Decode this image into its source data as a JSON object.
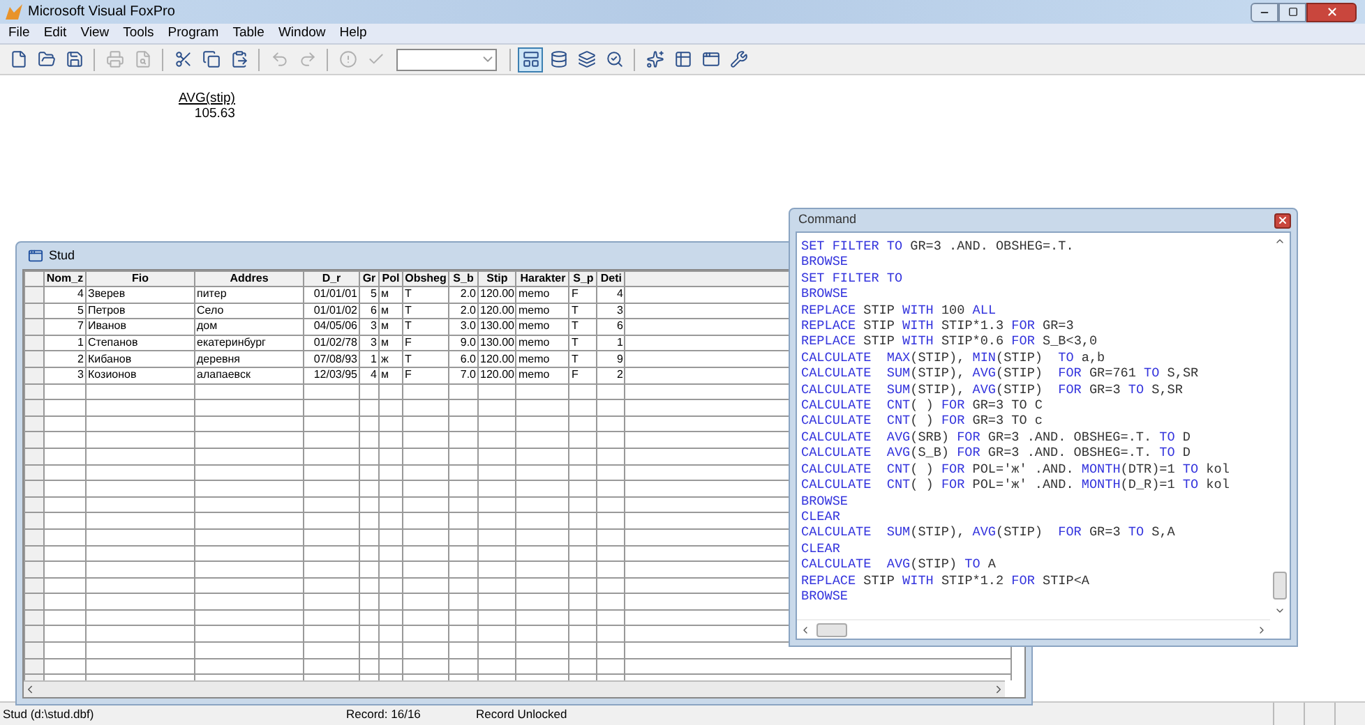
{
  "window": {
    "title": "Microsoft Visual FoxPro"
  },
  "menu": [
    "File",
    "Edit",
    "View",
    "Tools",
    "Program",
    "Table",
    "Window",
    "Help"
  ],
  "toolbar": [
    {
      "kind": "button",
      "disabled": false
    },
    {
      "kind": "button",
      "disabled": false
    },
    {
      "kind": "button",
      "disabled": false
    },
    {
      "kind": "separator"
    },
    {
      "kind": "button",
      "disabled": true
    },
    {
      "kind": "button",
      "disabled": true
    },
    {
      "kind": "separator"
    },
    {
      "kind": "button",
      "disabled": false
    },
    {
      "kind": "button",
      "disabled": false
    },
    {
      "kind": "button",
      "disabled": false
    },
    {
      "kind": "separator"
    },
    {
      "kind": "button",
      "disabled": true
    },
    {
      "kind": "button",
      "disabled": true
    },
    {
      "kind": "separator"
    },
    {
      "kind": "button",
      "disabled": true
    },
    {
      "kind": "button",
      "disabled": true
    },
    {
      "kind": "combo"
    },
    {
      "kind": "separator"
    },
    {
      "kind": "button",
      "disabled": false,
      "selected": true
    },
    {
      "kind": "button",
      "disabled": false,
      "selected": false
    },
    {
      "kind": "button",
      "disabled": false,
      "selected": false
    },
    {
      "kind": "button",
      "disabled": false,
      "selected": false
    },
    {
      "kind": "separator"
    },
    {
      "kind": "button",
      "disabled": false
    },
    {
      "kind": "button",
      "disabled": false
    },
    {
      "kind": "button",
      "disabled": false
    },
    {
      "kind": "button",
      "disabled": false
    }
  ],
  "output": {
    "heading": "AVG(stip)",
    "value": "105.63"
  },
  "browse_window": {
    "title": "Stud",
    "columns": [
      "Nom_z",
      "Fio",
      "Addres",
      "D_r",
      "Gr",
      "Pol",
      "Obsheg",
      "S_b",
      "Stip",
      "Harakter",
      "S_p",
      "Deti"
    ],
    "rows": [
      [
        "4",
        "Зверев",
        "питер",
        "01/01/01",
        "5",
        "м",
        "T",
        "2.0",
        "120.00",
        "memo",
        "F",
        "4"
      ],
      [
        "5",
        "Петров",
        "Село",
        "01/01/02",
        "6",
        "м",
        "T",
        "2.0",
        "120.00",
        "memo",
        "T",
        "3"
      ],
      [
        "7",
        "Иванов",
        "дом",
        "04/05/06",
        "3",
        "м",
        "T",
        "3.0",
        "130.00",
        "memo",
        "T",
        "6"
      ],
      [
        "1",
        "Степанов",
        "екатеринбург",
        "01/02/78",
        "3",
        "м",
        "F",
        "9.0",
        "130.00",
        "memo",
        "T",
        "1"
      ],
      [
        "2",
        "Кибанов",
        "деревня",
        "07/08/93",
        "1",
        "ж",
        "T",
        "6.0",
        "120.00",
        "memo",
        "T",
        "9"
      ],
      [
        "3",
        "Козионов",
        "алапаевск",
        "12/03/95",
        "4",
        "м",
        "F",
        "7.0",
        "120.00",
        "memo",
        "F",
        "2"
      ]
    ]
  },
  "command_window": {
    "title": "Command",
    "lines": [
      [
        {
          "kind": "kw",
          "text": "SET FILTER TO"
        },
        {
          "kind": "plain",
          "text": " GR=3 .AND. OBSHEG=.T."
        }
      ],
      [
        {
          "kind": "kw",
          "text": "BROWSE"
        }
      ],
      [
        {
          "kind": "kw",
          "text": "SET FILTER TO"
        }
      ],
      [
        {
          "kind": "kw",
          "text": "BROWSE"
        }
      ],
      [
        {
          "kind": "kw",
          "text": "REPLACE"
        },
        {
          "kind": "plain",
          "text": " STIP "
        },
        {
          "kind": "kw",
          "text": "WITH"
        },
        {
          "kind": "plain",
          "text": " 100 "
        },
        {
          "kind": "kw",
          "text": "ALL"
        }
      ],
      [
        {
          "kind": "kw",
          "text": "REPLACE"
        },
        {
          "kind": "plain",
          "text": " STIP "
        },
        {
          "kind": "kw",
          "text": "WITH"
        },
        {
          "kind": "plain",
          "text": " STIP*1.3 "
        },
        {
          "kind": "kw",
          "text": "FOR"
        },
        {
          "kind": "plain",
          "text": " GR=3"
        }
      ],
      [
        {
          "kind": "kw",
          "text": "REPLACE"
        },
        {
          "kind": "plain",
          "text": " STIP "
        },
        {
          "kind": "kw",
          "text": "WITH"
        },
        {
          "kind": "plain",
          "text": " STIP*0.6 "
        },
        {
          "kind": "kw",
          "text": "FOR"
        },
        {
          "kind": "plain",
          "text": " S_B<3,0"
        }
      ],
      [
        {
          "kind": "kw",
          "text": "CALCULATE  MAX"
        },
        {
          "kind": "plain",
          "text": "(STIP), "
        },
        {
          "kind": "kw",
          "text": "MIN"
        },
        {
          "kind": "plain",
          "text": "(STIP)  "
        },
        {
          "kind": "kw",
          "text": "TO"
        },
        {
          "kind": "plain",
          "text": " a,b"
        }
      ],
      [
        {
          "kind": "kw",
          "text": "CALCULATE  SUM"
        },
        {
          "kind": "plain",
          "text": "(STIP), "
        },
        {
          "kind": "kw",
          "text": "AVG"
        },
        {
          "kind": "plain",
          "text": "(STIP)  "
        },
        {
          "kind": "kw",
          "text": "FOR"
        },
        {
          "kind": "plain",
          "text": " GR=761 "
        },
        {
          "kind": "kw",
          "text": "TO"
        },
        {
          "kind": "plain",
          "text": " S,SR"
        }
      ],
      [
        {
          "kind": "kw",
          "text": "CALCULATE  SUM"
        },
        {
          "kind": "plain",
          "text": "(STIP), "
        },
        {
          "kind": "kw",
          "text": "AVG"
        },
        {
          "kind": "plain",
          "text": "(STIP)  "
        },
        {
          "kind": "kw",
          "text": "FOR"
        },
        {
          "kind": "plain",
          "text": " GR=3 "
        },
        {
          "kind": "kw",
          "text": "TO"
        },
        {
          "kind": "plain",
          "text": " S,SR"
        }
      ],
      [
        {
          "kind": "kw",
          "text": "CALCULATE  CNT"
        },
        {
          "kind": "plain",
          "text": "( ) "
        },
        {
          "kind": "kw",
          "text": "FOR"
        },
        {
          "kind": "plain",
          "text": " GR=3 TO C"
        }
      ],
      [
        {
          "kind": "kw",
          "text": "CALCULATE  CNT"
        },
        {
          "kind": "plain",
          "text": "( ) "
        },
        {
          "kind": "kw",
          "text": "FOR"
        },
        {
          "kind": "plain",
          "text": " GR=3 TO c"
        }
      ],
      [
        {
          "kind": "kw",
          "text": "CALCULATE  AVG"
        },
        {
          "kind": "plain",
          "text": "(SRB) "
        },
        {
          "kind": "kw",
          "text": "FOR"
        },
        {
          "kind": "plain",
          "text": " GR=3 .AND. OBSHEG=.T. "
        },
        {
          "kind": "kw",
          "text": "TO"
        },
        {
          "kind": "plain",
          "text": " D"
        }
      ],
      [
        {
          "kind": "kw",
          "text": "CALCULATE  AVG"
        },
        {
          "kind": "plain",
          "text": "(S_B) "
        },
        {
          "kind": "kw",
          "text": "FOR"
        },
        {
          "kind": "plain",
          "text": " GR=3 .AND. OBSHEG=.T. "
        },
        {
          "kind": "kw",
          "text": "TO"
        },
        {
          "kind": "plain",
          "text": " D"
        }
      ],
      [
        {
          "kind": "kw",
          "text": "CALCULATE  CNT"
        },
        {
          "kind": "plain",
          "text": "( ) "
        },
        {
          "kind": "kw",
          "text": "FOR"
        },
        {
          "kind": "plain",
          "text": " POL='ж' .AND. "
        },
        {
          "kind": "kw",
          "text": "MONTH"
        },
        {
          "kind": "plain",
          "text": "(DTR)=1 "
        },
        {
          "kind": "kw",
          "text": "TO"
        },
        {
          "kind": "plain",
          "text": " kol"
        }
      ],
      [
        {
          "kind": "kw",
          "text": "CALCULATE  CNT"
        },
        {
          "kind": "plain",
          "text": "( ) "
        },
        {
          "kind": "kw",
          "text": "FOR"
        },
        {
          "kind": "plain",
          "text": " POL='ж' .AND. "
        },
        {
          "kind": "kw",
          "text": "MONTH"
        },
        {
          "kind": "plain",
          "text": "(D_R)=1 "
        },
        {
          "kind": "kw",
          "text": "TO"
        },
        {
          "kind": "plain",
          "text": " kol"
        }
      ],
      [
        {
          "kind": "kw",
          "text": "BROWSE"
        }
      ],
      [
        {
          "kind": "kw",
          "text": "CLEAR"
        }
      ],
      [
        {
          "kind": "kw",
          "text": "CALCULATE  SUM"
        },
        {
          "kind": "plain",
          "text": "(STIP), "
        },
        {
          "kind": "kw",
          "text": "AVG"
        },
        {
          "kind": "plain",
          "text": "(STIP)  "
        },
        {
          "kind": "kw",
          "text": "FOR"
        },
        {
          "kind": "plain",
          "text": " GR=3 "
        },
        {
          "kind": "kw",
          "text": "TO"
        },
        {
          "kind": "plain",
          "text": " S,A"
        }
      ],
      [
        {
          "kind": "kw",
          "text": "CLEAR"
        }
      ],
      [
        {
          "kind": "kw",
          "text": "CALCULATE  AVG"
        },
        {
          "kind": "plain",
          "text": "(STIP) "
        },
        {
          "kind": "kw",
          "text": "TO"
        },
        {
          "kind": "plain",
          "text": " A"
        }
      ],
      [
        {
          "kind": "kw",
          "text": "REPLACE"
        },
        {
          "kind": "plain",
          "text": " STIP "
        },
        {
          "kind": "kw",
          "text": "WITH"
        },
        {
          "kind": "plain",
          "text": " STIP*1.2 "
        },
        {
          "kind": "kw",
          "text": "FOR"
        },
        {
          "kind": "plain",
          "text": " STIP<A"
        }
      ],
      [
        {
          "kind": "kw",
          "text": "BROWSE"
        }
      ]
    ]
  },
  "status_bar": [
    "Stud (d:\\stud.dbf)",
    "Record: 16/16",
    "Record Unlocked"
  ]
}
